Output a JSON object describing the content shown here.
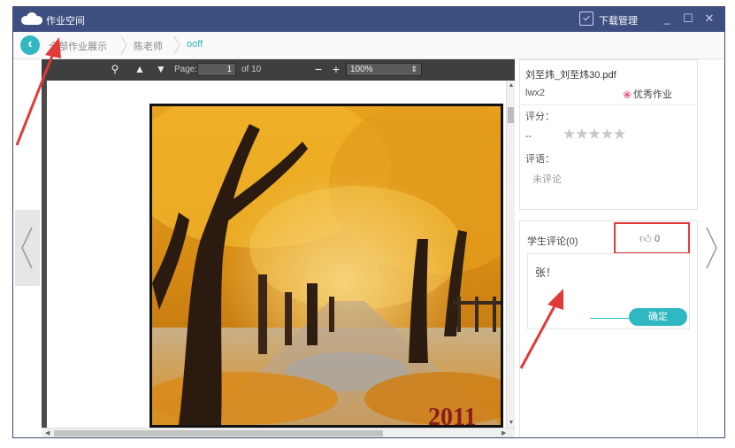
{
  "app": {
    "title": "作业空间",
    "download_label": "下载管理",
    "minimize": "_",
    "maximize": "☐",
    "close": "✕"
  },
  "breadcrumb": {
    "items": [
      "全部作业展示",
      "陈老师",
      "ooff"
    ]
  },
  "pdf_viewer": {
    "page_label": "Page:",
    "page_current": "1",
    "page_total": "of 10",
    "zoom_minus": "−",
    "zoom_plus": "+",
    "zoom_value": "100%",
    "photo_caption": "2011"
  },
  "info": {
    "file_name": "刘至炜_刘至炜30.pdf",
    "user_name": "lwx2",
    "badge": "优秀作业",
    "score_label": "评分：",
    "score_value": "--",
    "stars": "★★★★★",
    "rating": 0,
    "remark_label": "评语：",
    "remark_value": "未评论"
  },
  "comments": {
    "title": "学生评论(0)",
    "like_count": "0",
    "comment_text": "张！",
    "submit_label": "确定"
  },
  "colors": {
    "titlebar": "#3d4e80",
    "accent": "#2fb7c2",
    "highlight": "#e23a3a"
  }
}
